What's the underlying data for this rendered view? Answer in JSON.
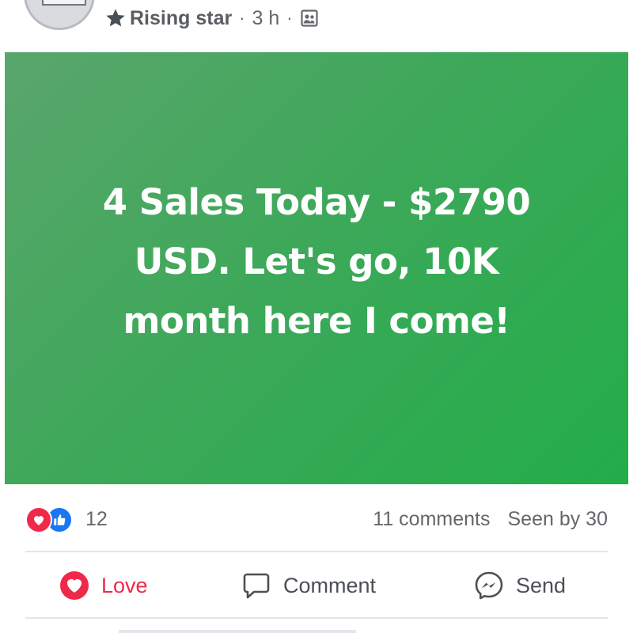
{
  "header": {
    "badge_label": "Rising star",
    "separator": "·",
    "time": "3 h"
  },
  "post": {
    "text": "4 Sales Today - $2790 USD. Let's go, 10K month here I come!",
    "background_colors": [
      "#5aa66c",
      "#22ad49"
    ]
  },
  "reactions": {
    "icons": [
      "love-icon",
      "like-icon"
    ],
    "count": "12",
    "comments": "11 comments",
    "seen_by": "Seen by 30"
  },
  "actions": {
    "love_label": "Love",
    "comment_label": "Comment",
    "send_label": "Send",
    "love_color": "#f0284a"
  }
}
